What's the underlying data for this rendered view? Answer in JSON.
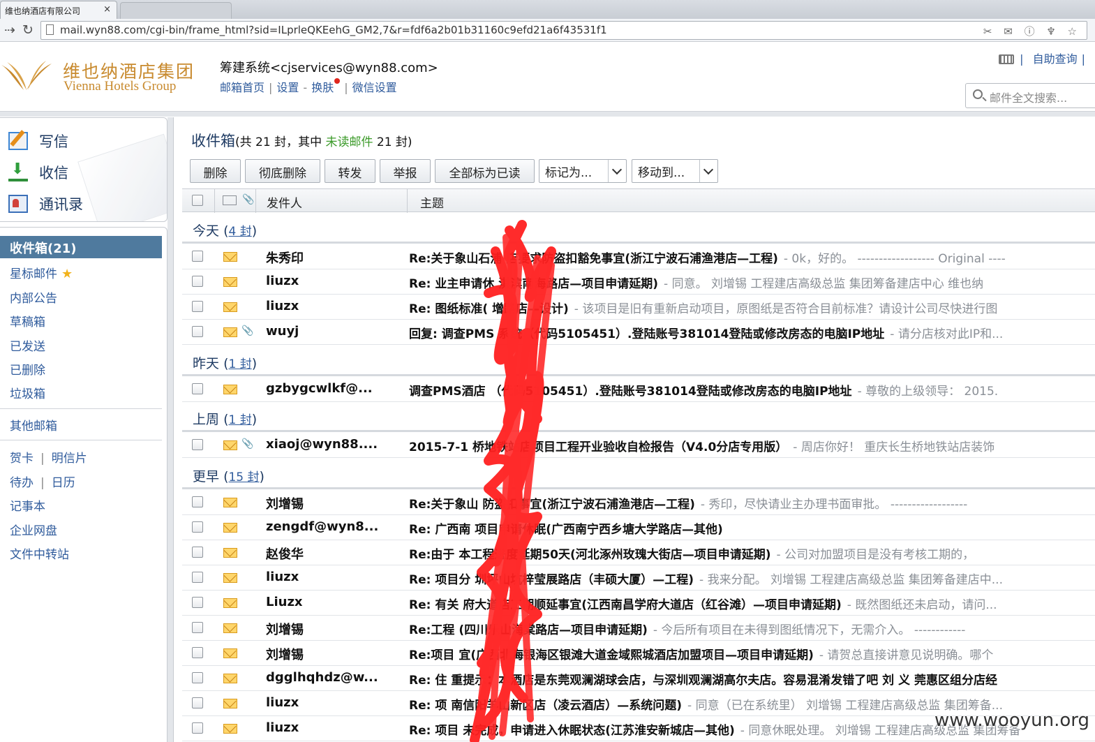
{
  "browser": {
    "tab_title": "维也纳酒店有限公司",
    "tab_close": "×",
    "url": "mail.wyn88.com/cgi-bin/frame_html?sid=ILprleQKEehG_GM2,7&r=fdf6a2b01b31160c9efd21a6f43531f1",
    "back": "⇢",
    "reload": "↻",
    "omni_icons": "✂ ✉ ⓘ ♆ ☆"
  },
  "header": {
    "logo_cn": "维也纳酒店集团",
    "logo_en": "Vienna Hotels Group",
    "account": "筹建系统<cjservices@wyn88.com>",
    "links": [
      "邮箱首页",
      "设置",
      "换肤",
      "微信设置"
    ],
    "link_seps": [
      "|",
      "-",
      "|"
    ],
    "self_service": "自助查询",
    "self_service_sep": "|",
    "search_placeholder": "邮件全文搜索..."
  },
  "quick": {
    "write": "写信",
    "inbox": "收信",
    "contacts": "通讯录"
  },
  "nav": {
    "active": "收件箱(21)",
    "items": [
      "星标邮件",
      "内部公告",
      "草稿箱",
      "已发送",
      "已删除",
      "垃圾箱"
    ],
    "other": "其他邮箱",
    "pair1": [
      "贺卡",
      "明信片"
    ],
    "pair2": [
      "待办",
      "日历"
    ],
    "pair_sep": "|",
    "tools": [
      "记事本",
      "企业网盘",
      "文件中转站"
    ]
  },
  "inbox": {
    "title": "收件箱",
    "summary_pre": "(共 21 封，其中 ",
    "unread_label": "未读邮件",
    "summary_post": " 21 封)"
  },
  "toolbar": {
    "delete": "删除",
    "purge": "彻底删除",
    "forward": "转发",
    "report": "举报",
    "mark_all_read": "全部标为已读",
    "mark_as": "标记为...",
    "move_to": "移动到..."
  },
  "columns": {
    "sender": "发件人",
    "subject": "主题"
  },
  "groups": [
    {
      "label": "今天",
      "count": "4 封"
    },
    {
      "label": "昨天",
      "count": "1 封"
    },
    {
      "label": "上周",
      "count": "1 封"
    },
    {
      "label": "更早",
      "count": "15 封"
    }
  ],
  "group_open": "(",
  "group_close": ")",
  "mails": [
    {
      "sender": "朱秀印",
      "subject": "Re:关于象山石浦      店要求防盗扣豁免事宜(浙江宁波石浦渔港店—工程)",
      "preview": "- 0k，好的。 ------------------ Original ----",
      "attach": false
    },
    {
      "sender": "liuzx",
      "subject": "Re: 业主申请休           淇滨南海路店—项目申请延期)",
      "preview": "- 同意。 刘增锡 工程建店高级总监 集团筹备建店中心 维也纳",
      "attach": false
    },
    {
      "sender": "liuzx",
      "subject": "Re: 图纸标准(           增路店—设计)",
      "preview": "- 该项目是旧有重新启动项目，原图纸是否符合目前标准？请设计公司尽快进行图",
      "attach": false
    },
    {
      "sender": "wuyj",
      "subject": "回复: 调查PMS        系统（代码5105451）.登陆账号381014登陆或修改房态的电脑IP地址",
      "preview": "- 请分店核对此IP和...",
      "attach": true
    },
    {
      "sender": "gzbygcwlkf@...",
      "subject": "调查PMS酒店        （代码5105451）.登陆账号381014登陆或修改房态的电脑IP地址",
      "preview": "- 尊敬的上级领导： 2015.",
      "attach": false
    },
    {
      "sender": "xiaoj@wyn88....",
      "subject": "2015-7-1          桥地铁站店项目工程开业验收自检报告（V4.0分店专用版）",
      "preview": "- 周店你好！ 重庆长生桥地铁站店装饰",
      "attach": true
    },
    {
      "sender": "刘增锡",
      "subject": "Re:关于象山        防盗扣事宜(浙江宁波石浦渔港店—工程)",
      "preview": "- 秀印，尽快请业主办理书面审批。 ------------------ ",
      "attach": false
    },
    {
      "sender": "zengdf@wyn8...",
      "subject": "Re: 广西南        项目申请休眠(广西南宁西乡塘大学路店—其他)",
      "preview": "",
      "attach": false
    },
    {
      "sender": "赵俊华",
      "subject": "Re:由于          本工程进度延期50天(河北涿州玫瑰大街店—项目申请延期)",
      "preview": "- 公司对加盟项目是没有考核工期的，",
      "attach": false
    },
    {
      "sender": "liuzx",
      "subject": "Re: 项目分          圳坪山坑梓莹展路店（丰硕大厦）—工程)",
      "preview": "- 我来分配。 刘增锡 工程建店高级总监 集团筹备建店中...",
      "attach": false
    },
    {
      "sender": "Liuzx",
      "subject": "Re: 有关         府大道店工期顺延事宜(江西南昌学府大道店（红谷滩）—项目申请延期)",
      "preview": "- 既然图纸还未启动，请问...",
      "attach": false
    },
    {
      "sender": "刘增锡",
      "subject": "Re:工程         (四川乐山海棠路店—项目申请延期)",
      "preview": "- 今后所有项目在未得到图纸情况下，无需介入。 ------------",
      "attach": false
    },
    {
      "sender": "刘增锡",
      "subject": "Re:项目         宜(广西北海银海区银滩大道金域熙城酒店加盟项目—项目申请延期)",
      "preview": "- 请贺总直接讲意见说明确。哪个",
      "attach": false
    },
    {
      "sender": "dgglhqhdz@w...",
      "subject": "Re: 住        重提示：本酒店是东莞观澜湖球会店，与深圳观澜湖高尔夫店。容易混淆发错了吧 刘 义 莞惠区组分店经",
      "preview": "",
      "attach": false
    },
    {
      "sender": "liuzx",
      "subject": "Re: 项        南信阳羊山新区店（凌云酒店）—系统问题)",
      "preview": "- 同意（已在系统里） 刘增锡 工程建店高级总监 集团筹备...",
      "attach": false
    },
    {
      "sender": "liuzx",
      "subject": "Re: 项目      未完成，申请进入休眠状态(江苏淮安新城店—其他)",
      "preview": "- 同意休眠处理。 刘增锡 工程建店高级总监 集团筹备",
      "attach": false
    }
  ],
  "watermark": "www.wooyun.org"
}
